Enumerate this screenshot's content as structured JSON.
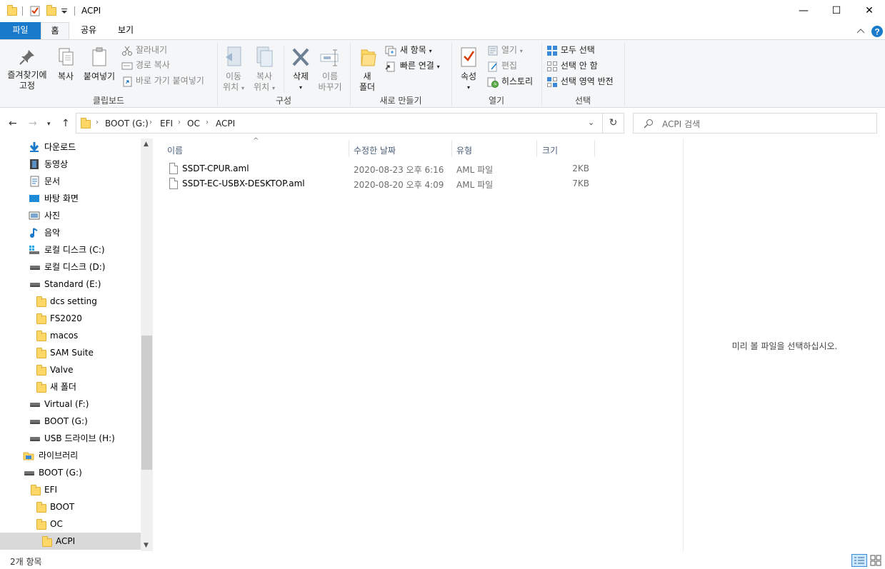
{
  "window": {
    "title": "ACPI",
    "minimize": "—",
    "maximize": "☐",
    "close": "✕"
  },
  "tabs": [
    {
      "label": "파일"
    },
    {
      "label": "홈"
    },
    {
      "label": "공유"
    },
    {
      "label": "보기"
    }
  ],
  "ribbon": {
    "clipboard": {
      "group_label": "클립보드",
      "pin_line1": "즐겨찾기에",
      "pin_line2": "고정",
      "copy": "복사",
      "paste": "붙여넣기",
      "cut": "잘라내기",
      "copy_path": "경로 복사",
      "paste_shortcut": "바로 가기 붙여넣기"
    },
    "organize": {
      "group_label": "구성",
      "move_line1": "이동",
      "move_line2": "위치",
      "copyto_line1": "복사",
      "copyto_line2": "위치",
      "delete": "삭제",
      "rename_line1": "이름",
      "rename_line2": "바꾸기"
    },
    "new": {
      "group_label": "새로 만들기",
      "new_folder_line1": "새",
      "new_folder_line2": "폴더",
      "new_item": "새 항목",
      "easy_access": "빠른 연결"
    },
    "open": {
      "group_label": "열기",
      "properties": "속성",
      "open": "열기",
      "edit": "편집",
      "history": "히스토리"
    },
    "select": {
      "group_label": "선택",
      "select_all": "모두 선택",
      "select_none": "선택 안 함",
      "invert": "선택 영역 반전"
    }
  },
  "address": {
    "crumbs": [
      "BOOT (G:)",
      "EFI",
      "OC",
      "ACPI"
    ],
    "search_placeholder": "ACPI 검색"
  },
  "nav": {
    "items": [
      {
        "label": "다운로드"
      },
      {
        "label": "동영상"
      },
      {
        "label": "문서"
      },
      {
        "label": "바탕 화면"
      },
      {
        "label": "사진"
      },
      {
        "label": "음악"
      },
      {
        "label": "로컬 디스크 (C:)"
      },
      {
        "label": "로컬 디스크 (D:)"
      },
      {
        "label": "Standard (E:)"
      },
      {
        "label": "dcs setting"
      },
      {
        "label": "FS2020"
      },
      {
        "label": "macos"
      },
      {
        "label": "SAM Suite"
      },
      {
        "label": "Valve"
      },
      {
        "label": "새 폴더"
      },
      {
        "label": "Virtual (F:)"
      },
      {
        "label": "BOOT (G:)"
      },
      {
        "label": "USB 드라이브 (H:)"
      },
      {
        "label": "라이브러리"
      },
      {
        "label": "BOOT (G:)"
      },
      {
        "label": "EFI"
      },
      {
        "label": "BOOT"
      },
      {
        "label": "OC"
      },
      {
        "label": "ACPI"
      }
    ]
  },
  "columns": {
    "name": "이름",
    "modified": "수정한 날짜",
    "type": "유형",
    "size": "크기"
  },
  "files": [
    {
      "name": "SSDT-CPUR.aml",
      "modified": "2020-08-23 오후 6:16",
      "type": "AML 파일",
      "size": "2KB"
    },
    {
      "name": "SSDT-EC-USBX-DESKTOP.aml",
      "modified": "2020-08-20 오후 4:09",
      "type": "AML 파일",
      "size": "7KB"
    }
  ],
  "preview": {
    "message": "미리 볼 파일을 선택하십시오."
  },
  "status": {
    "count": "2개 항목"
  },
  "colors": {
    "accent": "#1979ca",
    "ribbon_bg": "#f5f6f7",
    "selection": "#d9d9d9",
    "folder": "#ffd766"
  }
}
